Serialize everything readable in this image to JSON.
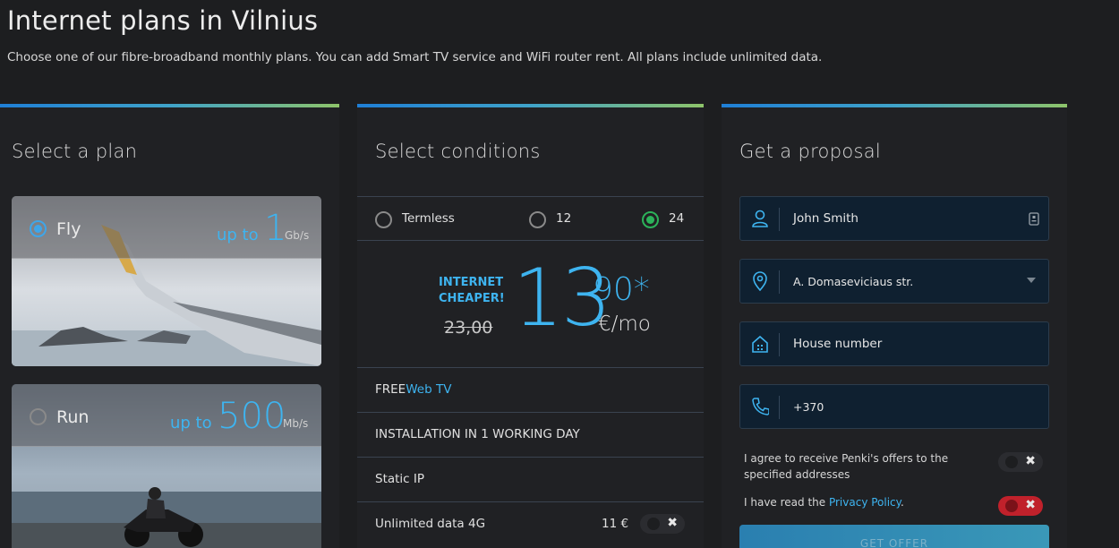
{
  "page": {
    "title": "Internet plans in Vilnius",
    "subtitle": "Choose one of our fibre-broadband monthly plans. You can add Smart TV service and WiFi router rent. All plans include unlimited data."
  },
  "plan": {
    "heading": "Select a plan",
    "plans": [
      {
        "name": "Fly",
        "upto": "up to",
        "speed": "1",
        "unit": "Gb/s",
        "selected": true,
        "icon": "airplane-photo"
      },
      {
        "name": "Run",
        "upto": "up to",
        "speed": "500",
        "unit": "Mb/s",
        "selected": false,
        "icon": "motorcycle-photo"
      }
    ]
  },
  "conditions": {
    "heading": "Select conditions",
    "terms": [
      {
        "label": "Termless",
        "selected": false
      },
      {
        "label": "12",
        "selected": false
      },
      {
        "label": "24",
        "selected": true
      }
    ],
    "promo": "INTERNET CHEAPER!",
    "old_price": "23,00",
    "price_int": "13",
    "price_dec": "90*",
    "price_unit": "€/mo",
    "features": [
      {
        "prefix": "FREE",
        "highlight": "Web TV"
      },
      {
        "label": "INSTALLATION IN 1 WORKING DAY"
      },
      {
        "label": "Static IP"
      },
      {
        "label": "Unlimited data 4G",
        "price": "11 €",
        "enabled": false
      }
    ]
  },
  "proposal": {
    "heading": "Get a proposal",
    "name_value": "John Smith",
    "address_value": "A. Domaseviciaus str.",
    "house_placeholder": "House number",
    "phone_value": "+370",
    "consent_offers": "I agree to receive Penki's offers to the specified addresses",
    "consent_privacy_prefix": "I have read the ",
    "consent_privacy_link": "Privacy Policy",
    "consent_privacy_suffix": ".",
    "submit_label": "GET OFFER"
  },
  "colors": {
    "accent": "#3eb4f0",
    "selected_radio": "#2cb35a",
    "error": "#c0212b"
  }
}
